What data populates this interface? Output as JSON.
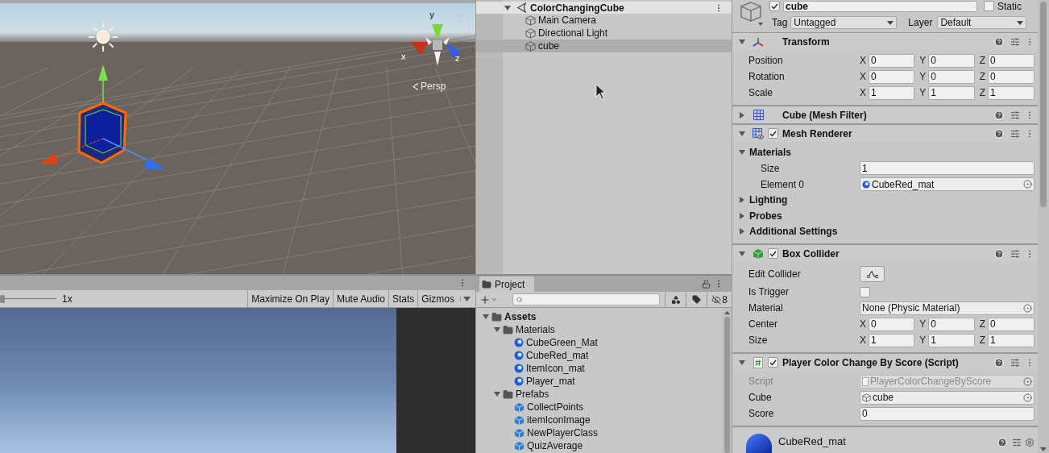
{
  "scene": {
    "gizmo_axes": [
      "y",
      "x",
      "z"
    ],
    "view_mode": "Persp"
  },
  "game": {
    "scale": "1x",
    "scale_slider": {
      "level": 0
    },
    "toggles": [
      {
        "label": "Maximize On Play",
        "on": false,
        "kind": "toggle"
      },
      {
        "label": "Mute Audio",
        "on": false,
        "kind": "toggle"
      },
      {
        "label": "Stats",
        "on": false,
        "kind": "toggle"
      },
      {
        "label": "Gizmos",
        "on": false,
        "kind": "dropdown"
      }
    ]
  },
  "hierarchy": {
    "scene": {
      "label": "ColorChangingCube",
      "expanded": true
    },
    "items": [
      {
        "label": "Main Camera",
        "selected": false
      },
      {
        "label": "Directional Light",
        "selected": false
      },
      {
        "label": "cube",
        "selected": true
      }
    ]
  },
  "project": {
    "tab": "Project",
    "hidden_count": "8",
    "tree": [
      {
        "label": "Assets",
        "kind": "folder",
        "expanded": true,
        "children": [
          {
            "label": "Materials",
            "kind": "folder",
            "expanded": true,
            "children": [
              {
                "label": "CubeGreen_Mat",
                "kind": "material"
              },
              {
                "label": "CubeRed_mat",
                "kind": "material"
              },
              {
                "label": "ItemIcon_mat",
                "kind": "material"
              },
              {
                "label": "Player_mat",
                "kind": "material"
              }
            ]
          },
          {
            "label": "Prefabs",
            "kind": "folder",
            "expanded": true,
            "children": [
              {
                "label": "CollectPoints",
                "kind": "prefab"
              },
              {
                "label": "itemIconImage",
                "kind": "prefab"
              },
              {
                "label": "NewPlayerClass",
                "kind": "prefab"
              },
              {
                "label": "QuizAverage",
                "kind": "prefab"
              }
            ]
          }
        ]
      }
    ]
  },
  "inspector": {
    "active": true,
    "name": "cube",
    "static": {
      "label": "Static",
      "checked": false
    },
    "tag": {
      "label": "Tag",
      "value": "Untagged"
    },
    "layer": {
      "label": "Layer",
      "value": "Default"
    },
    "components": [
      {
        "kind": "transform",
        "title": "Transform",
        "expanded": true,
        "rows": [
          {
            "kind": "vector",
            "label": "Position",
            "values": [
              {
                "axis": "X",
                "value": "0"
              },
              {
                "axis": "Y",
                "value": "0"
              },
              {
                "axis": "Z",
                "value": "0"
              }
            ]
          },
          {
            "kind": "vector",
            "label": "Rotation",
            "values": [
              {
                "axis": "X",
                "value": "0"
              },
              {
                "axis": "Y",
                "value": "0"
              },
              {
                "axis": "Z",
                "value": "0"
              }
            ]
          },
          {
            "kind": "vector",
            "label": "Scale",
            "values": [
              {
                "axis": "X",
                "value": "1"
              },
              {
                "axis": "Y",
                "value": "1"
              },
              {
                "axis": "Z",
                "value": "1"
              }
            ]
          }
        ]
      },
      {
        "kind": "mesh_filter",
        "title": "Cube (Mesh Filter)",
        "expanded": false
      },
      {
        "kind": "mesh_renderer",
        "title": "Mesh Renderer",
        "enabled": true,
        "expanded": true,
        "rows": [
          {
            "kind": "foldout",
            "label": "Materials",
            "expanded": true,
            "children": [
              {
                "kind": "text",
                "label": "Size",
                "value": "1"
              },
              {
                "kind": "material_ref",
                "label": "Element 0",
                "value": "CubeRed_mat"
              }
            ]
          },
          {
            "kind": "foldout",
            "label": "Lighting",
            "expanded": false
          },
          {
            "kind": "foldout",
            "label": "Probes",
            "expanded": false
          },
          {
            "kind": "foldout",
            "label": "Additional Settings",
            "expanded": false
          }
        ]
      },
      {
        "kind": "box_collider",
        "title": "Box Collider",
        "enabled": true,
        "expanded": true,
        "rows": [
          {
            "kind": "button",
            "label": "Edit Collider"
          },
          {
            "kind": "checkbox",
            "label": "Is Trigger",
            "checked": false
          },
          {
            "kind": "object",
            "label": "Material",
            "value": "None (Physic Material)"
          },
          {
            "kind": "vector",
            "label": "Center",
            "values": [
              {
                "axis": "X",
                "value": "0"
              },
              {
                "axis": "Y",
                "value": "0"
              },
              {
                "axis": "Z",
                "value": "0"
              }
            ]
          },
          {
            "kind": "vector",
            "label": "Size",
            "values": [
              {
                "axis": "X",
                "value": "1"
              },
              {
                "axis": "Y",
                "value": "1"
              },
              {
                "axis": "Z",
                "value": "1"
              }
            ]
          }
        ]
      },
      {
        "kind": "script",
        "title": "Player Color Change By Score (Script)",
        "enabled": true,
        "expanded": true,
        "rows": [
          {
            "kind": "script_ref",
            "label": "Script",
            "value": "PlayerColorChangeByScore",
            "disabled": true
          },
          {
            "kind": "gameobject_ref",
            "label": "Cube",
            "value": "cube"
          },
          {
            "kind": "text",
            "label": "Score",
            "value": "0"
          }
        ]
      }
    ],
    "material": {
      "name": "CubeRed_mat"
    }
  }
}
